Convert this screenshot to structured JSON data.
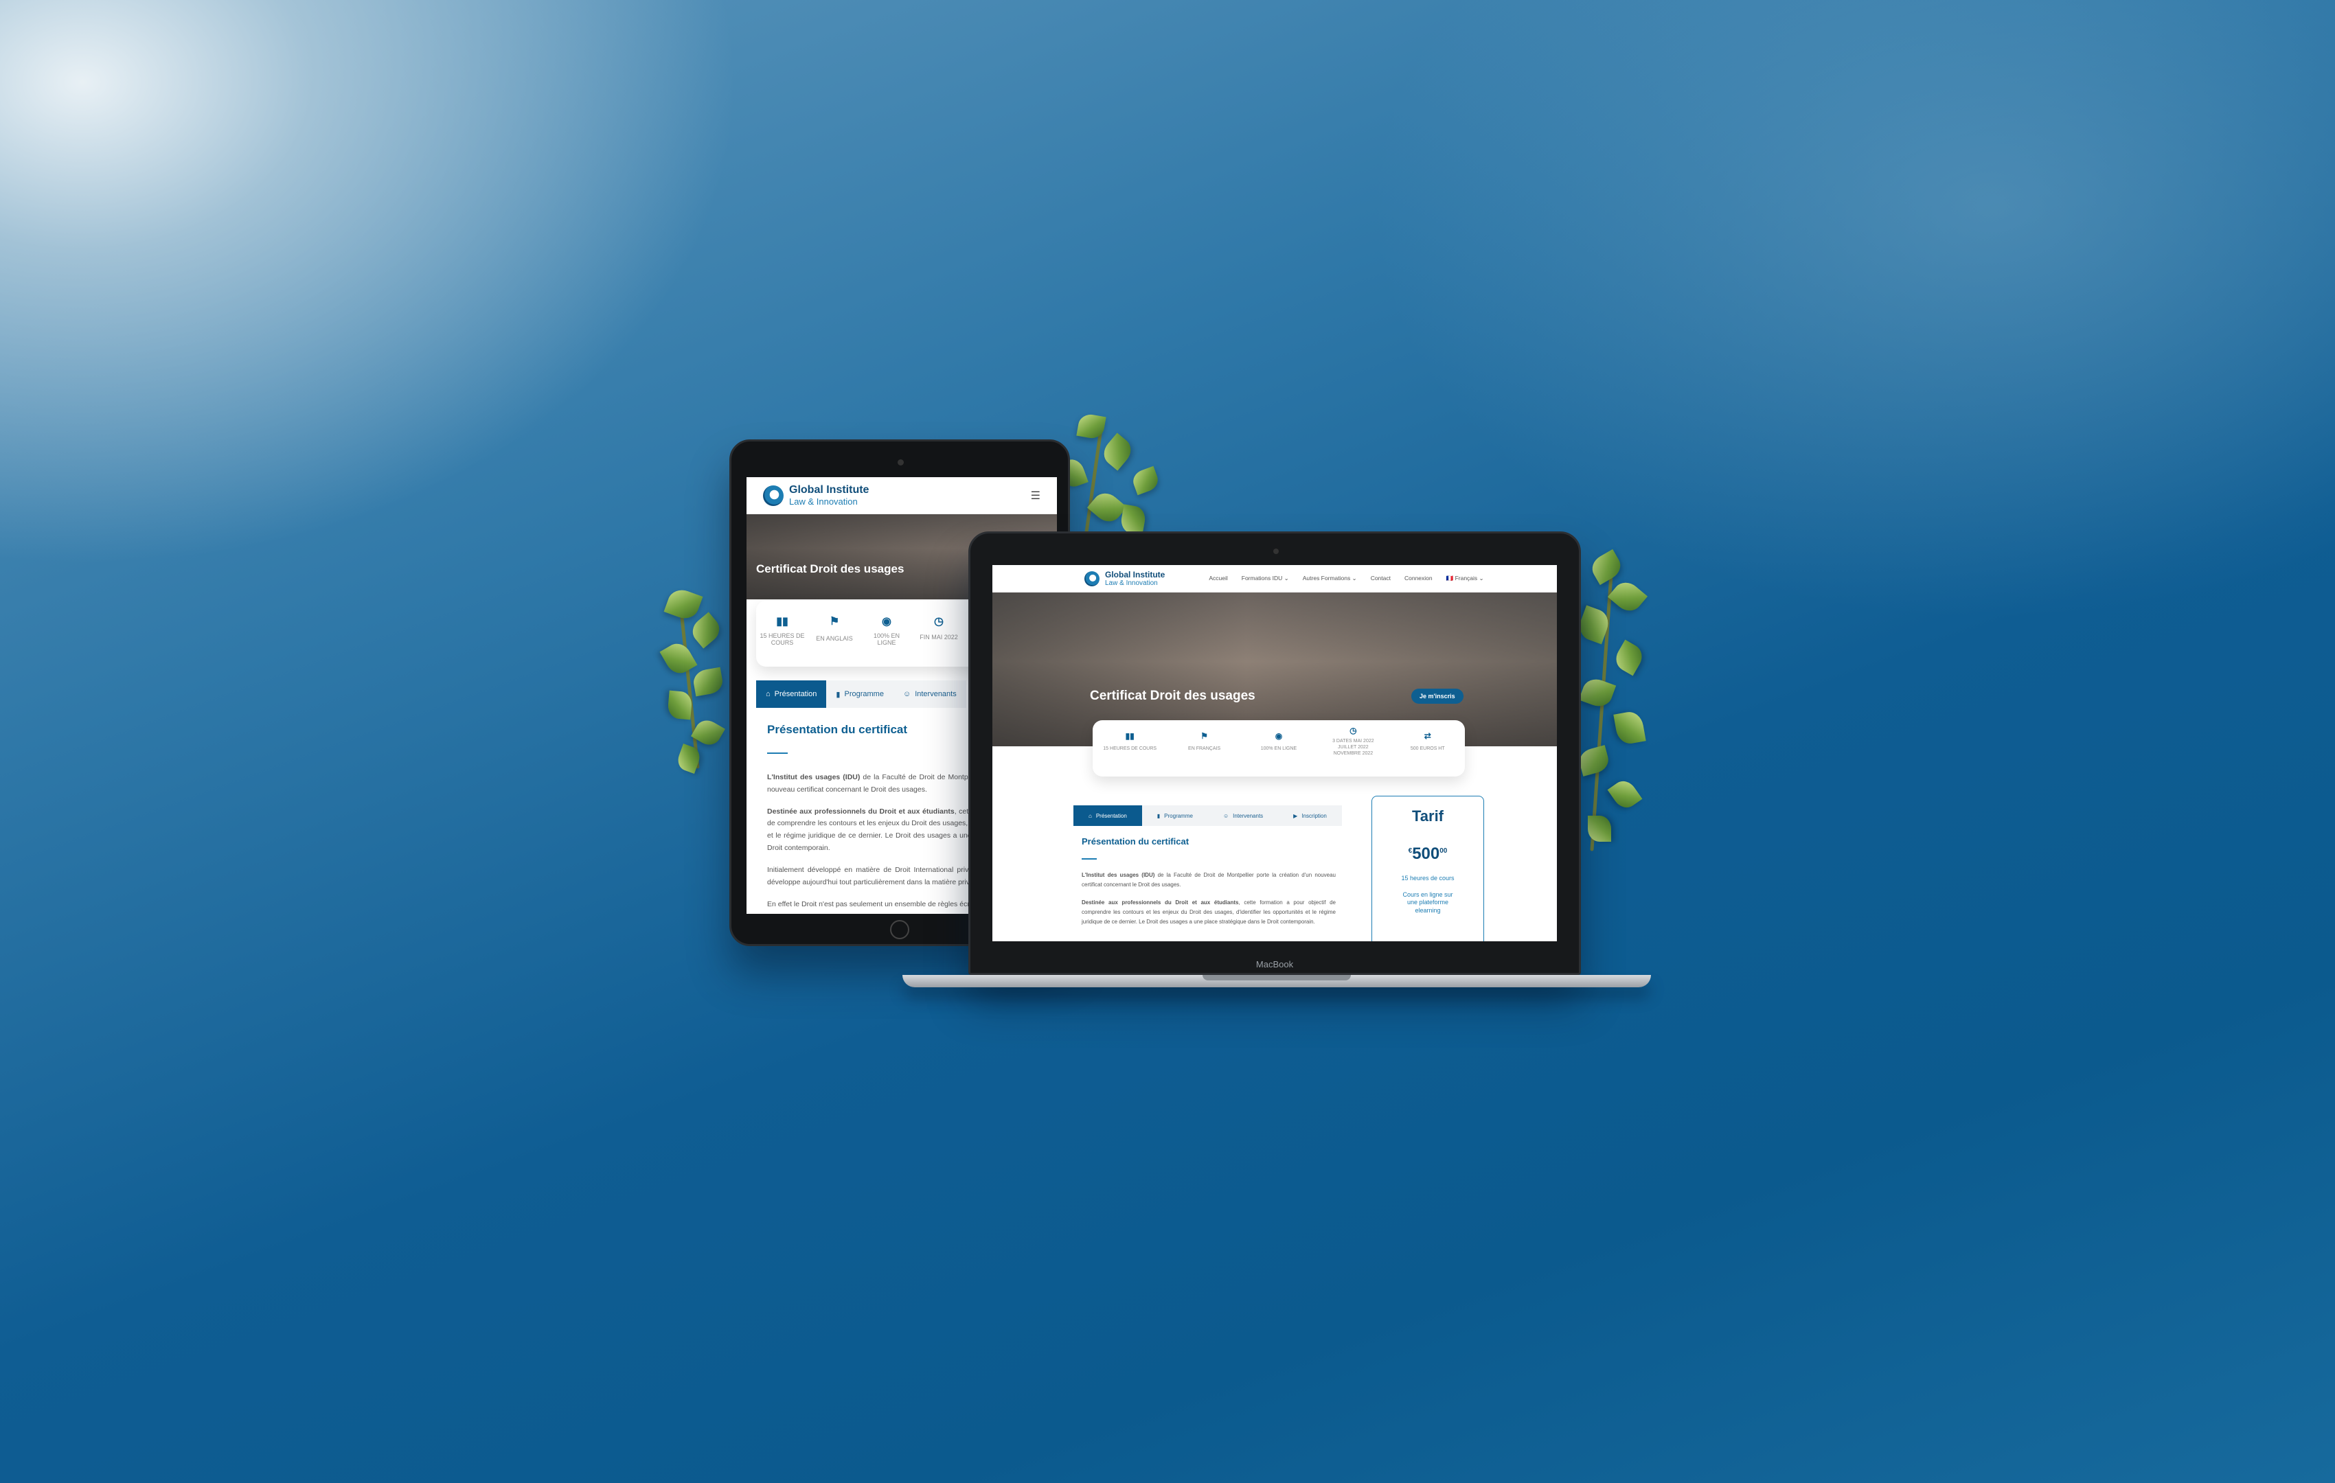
{
  "brand": {
    "name": "Global Institute",
    "tagline": "Law & Innovation"
  },
  "tablet": {
    "menu_icon": "hamburger-icon",
    "hero_title": "Certificat Droit des usages",
    "stats": [
      {
        "icon": "book-icon",
        "label": "15 HEURES DE COURS"
      },
      {
        "icon": "flag-icon",
        "label": "EN ANGLAIS"
      },
      {
        "icon": "globe-icon",
        "label": "100% EN LIGNE"
      },
      {
        "icon": "clock-icon",
        "label": "FIN MAI 2022"
      }
    ],
    "tabs": [
      "Présentation",
      "Programme",
      "Intervenants"
    ],
    "section_title": "Présentation du certificat",
    "paragraphs": [
      {
        "bold": "L'Institut des usages (IDU)",
        "text": " de la Faculté de Droit de Montpellier porte la création d'un nouveau certificat concernant le Droit des usages."
      },
      {
        "bold": "Destinée aux professionnels du Droit et aux étudiants",
        "text": ", cette formation a pour objectif de comprendre les contours et les enjeux du Droit des usages, d'identifier les opportunités et le régime juridique de ce dernier. Le Droit des usages a une place stratégique dans le Droit contemporain."
      },
      {
        "bold": "",
        "text": "Initialement développé en matière de Droit International privé, le Droit des usages se développe aujourd'hui tout particulièrement dans la matière privée."
      },
      {
        "bold": "",
        "text": "En effet le Droit n'est pas seulement un ensemble de règles écrites"
      }
    ]
  },
  "laptop": {
    "device_label": "MacBook",
    "nav": [
      "Accueil",
      "Formations IDU ⌄",
      "Autres Formations ⌄",
      "Contact",
      "Connexion",
      "🇫🇷 Français ⌄"
    ],
    "hero_title": "Certificat Droit des usages",
    "cta": "Je m'inscris",
    "stats": [
      {
        "icon": "book-icon",
        "label": "15 HEURES DE COURS"
      },
      {
        "icon": "flag-icon",
        "label": "EN FRANÇAIS"
      },
      {
        "icon": "globe-icon",
        "label": "100% EN LIGNE"
      },
      {
        "icon": "clock-icon",
        "label": "3 DATES MAI 2022 JUILLET 2022 NOVEMBRE 2022"
      },
      {
        "icon": "handshake-icon",
        "label": "500 EUROS HT"
      }
    ],
    "tabs": [
      "Présentation",
      "Programme",
      "Intervenants",
      "Inscription"
    ],
    "section_title": "Présentation du certificat",
    "paragraphs": [
      {
        "bold": "L'Institut des usages (IDU)",
        "text": " de la Faculté de Droit de Montpellier porte la création d'un nouveau certificat concernant le Droit des usages."
      },
      {
        "bold": "Destinée aux professionnels du Droit et aux étudiants",
        "text": ", cette formation a pour objectif de comprendre les contours et les enjeux du Droit des usages, d'identifier les opportunités et le régime juridique de ce dernier. Le Droit des usages a une place stratégique dans le Droit contemporain."
      }
    ],
    "tarif": {
      "title": "Tarif",
      "currency": "€",
      "price": "500",
      "cents": "00",
      "line1": "15 heures de cours",
      "line2": "Cours en ligne sur une plateforme elearning"
    }
  },
  "colors": {
    "primary": "#0b5a8e",
    "accent": "#1d7db3",
    "background": "#0f5d93"
  }
}
